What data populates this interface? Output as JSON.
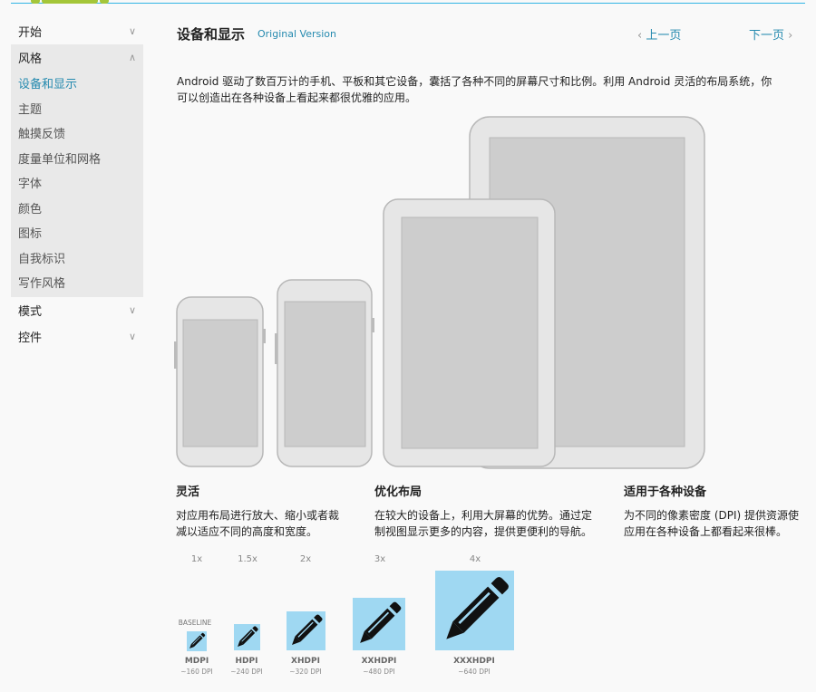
{
  "sidebar": {
    "sections": [
      {
        "label": "开始",
        "expanded": false
      },
      {
        "label": "风格",
        "expanded": true
      },
      {
        "label": "模式",
        "expanded": false
      },
      {
        "label": "控件",
        "expanded": false
      }
    ],
    "style_items": [
      {
        "label": "设备和显示",
        "active": true
      },
      {
        "label": "主题",
        "active": false
      },
      {
        "label": "触摸反馈",
        "active": false
      },
      {
        "label": "度量单位和网格",
        "active": false
      },
      {
        "label": "字体",
        "active": false
      },
      {
        "label": "颜色",
        "active": false
      },
      {
        "label": "图标",
        "active": false
      },
      {
        "label": "自我标识",
        "active": false
      },
      {
        "label": "写作风格",
        "active": false
      }
    ]
  },
  "header": {
    "title": "设备和显示",
    "original_version": "Original Version",
    "prev": "上一页",
    "next": "下一页"
  },
  "intro": {
    "line1": "Android 驱动了数百万计的手机、平板和其它设备，囊括了各种不同的屏幕尺寸和比例。利用 Android 灵活的布局系统，你",
    "line2": "可以创造出在各种设备上看起来都很优雅的应用。"
  },
  "features": [
    {
      "title": "灵活",
      "line1": "对应用布局进行放大、缩小或者裁",
      "line2": "减以适应不同的高度和宽度。"
    },
    {
      "title": "优化布局",
      "line1": "在较大的设备上，利用大屏幕的优势。通过定",
      "line2": "制视图显示更多的内容，提供更便利的导航。"
    },
    {
      "title": "适用于各种设备",
      "line1": "为不同的像素密度 (DPI) 提供资源使",
      "line2": "应用在各种设备上都看起来很棒。"
    }
  ],
  "dpi_chart": {
    "baseline_label": "BASELINE",
    "buckets": [
      {
        "scale": "1x",
        "name": "MDPI",
        "dpi": "~160 DPI"
      },
      {
        "scale": "1.5x",
        "name": "HDPI",
        "dpi": "~240 DPI"
      },
      {
        "scale": "2x",
        "name": "XHDPI",
        "dpi": "~320 DPI"
      },
      {
        "scale": "3x",
        "name": "XXHDPI",
        "dpi": "~480 DPI"
      },
      {
        "scale": "4x",
        "name": "XXXHDPI",
        "dpi": "~640 DPI"
      }
    ],
    "icon": "pencil-icon",
    "tile_color": "#9fd8f2"
  },
  "colors": {
    "accent": "#33b5e5",
    "link": "#258aaf",
    "android_green": "#a4c639"
  }
}
